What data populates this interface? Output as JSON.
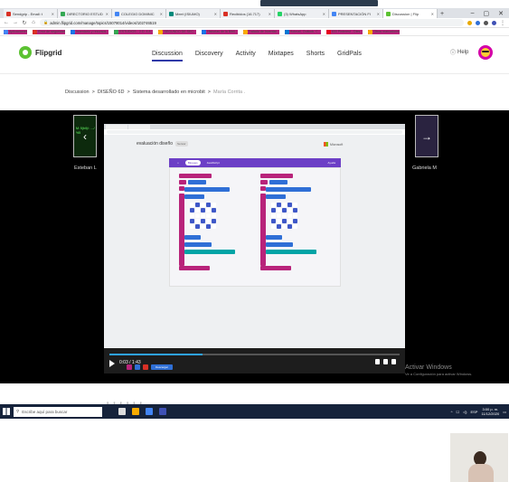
{
  "browser": {
    "tabs": [
      {
        "label": "Sendgrip - Email: t",
        "color": "#d93025",
        "active": false
      },
      {
        "label": "DIRECTORIO ESTUD",
        "color": "#34a853",
        "active": false
      },
      {
        "label": "COLEGIO DOMINIC",
        "color": "#4285f4",
        "active": false
      },
      {
        "label": "Meet (ISIUMO)",
        "color": "#00897b",
        "active": false
      },
      {
        "label": "Recibidos (16.717)",
        "color": "#d93025",
        "active": false
      },
      {
        "label": "(3) WhatsApp",
        "color": "#25d366",
        "active": false
      },
      {
        "label": "PRESENTACIÓN FI",
        "color": "#4285f4",
        "active": false
      },
      {
        "label": "Discussion | Flip",
        "color": "#5cc232",
        "active": true
      }
    ],
    "url": "admin.flipgrid.com/manage/topics/15078014/videos/102746519",
    "bookmarks": [
      {
        "label": "Aplicaciones",
        "color": "#4285f4"
      },
      {
        "label": "Error de seguridad",
        "color": "#d93025"
      },
      {
        "label": "Inventario y recursos...",
        "color": "#1a73e8"
      },
      {
        "label": "ESTUDIOS - 2.D. 4.8...",
        "color": "#34a853"
      },
      {
        "label": "SEGUNDO DE SEC...",
        "color": "#f9ab00"
      },
      {
        "label": "Historias de la Bibli...",
        "color": "#1a73e8"
      },
      {
        "label": "Tratado de Inventar...",
        "color": "#f9ab00"
      },
      {
        "label": "Hotmail, Outlook, C...",
        "color": "#0078d4"
      },
      {
        "label": "600 Pinterest - Dies...",
        "color": "#e60023"
      },
      {
        "label": "Otros marcadores",
        "color": "#f9ab00"
      }
    ]
  },
  "app": {
    "brand": "Flipgrid",
    "nav": [
      "Discussion",
      "Discovery",
      "Activity",
      "Mixtapes",
      "Shorts",
      "GridPals"
    ],
    "help": "Help"
  },
  "breadcrumb": {
    "items": [
      "Discussion",
      ">",
      "DISEÑO 6D",
      ">",
      "Sistema desarrollado en microbit",
      ">"
    ],
    "current": "María Corrita ."
  },
  "viewer": {
    "left_name": "Esteban L",
    "right_name": "Gabriela M",
    "left_thumb_text": "M: 5(bit)/: ..../ %5",
    "time": "0:03 / 1:43",
    "progress_fraction": 0.32
  },
  "shared_screen": {
    "title": "evaluación diseño",
    "pill": "Sensor",
    "vendor": "Microsoft",
    "toolbar": [
      "Bloques",
      "JavaScript"
    ],
    "help_label": "Ayuda",
    "download": "Descargar"
  },
  "windows": {
    "activate_title": "Activar Windows",
    "activate_sub": "Ve a Configuración para activar Windows.",
    "search_placeholder": "Escribe aquí para buscar",
    "clock_time": "3:00 p. m.",
    "clock_date": "11/12/2020",
    "lang": "ESP"
  },
  "colors": {
    "brand_green": "#5cc232",
    "active_nav": "#2f3aa8",
    "makecode_purple": "#6c3fc6",
    "block_magenta": "#b8237a"
  }
}
